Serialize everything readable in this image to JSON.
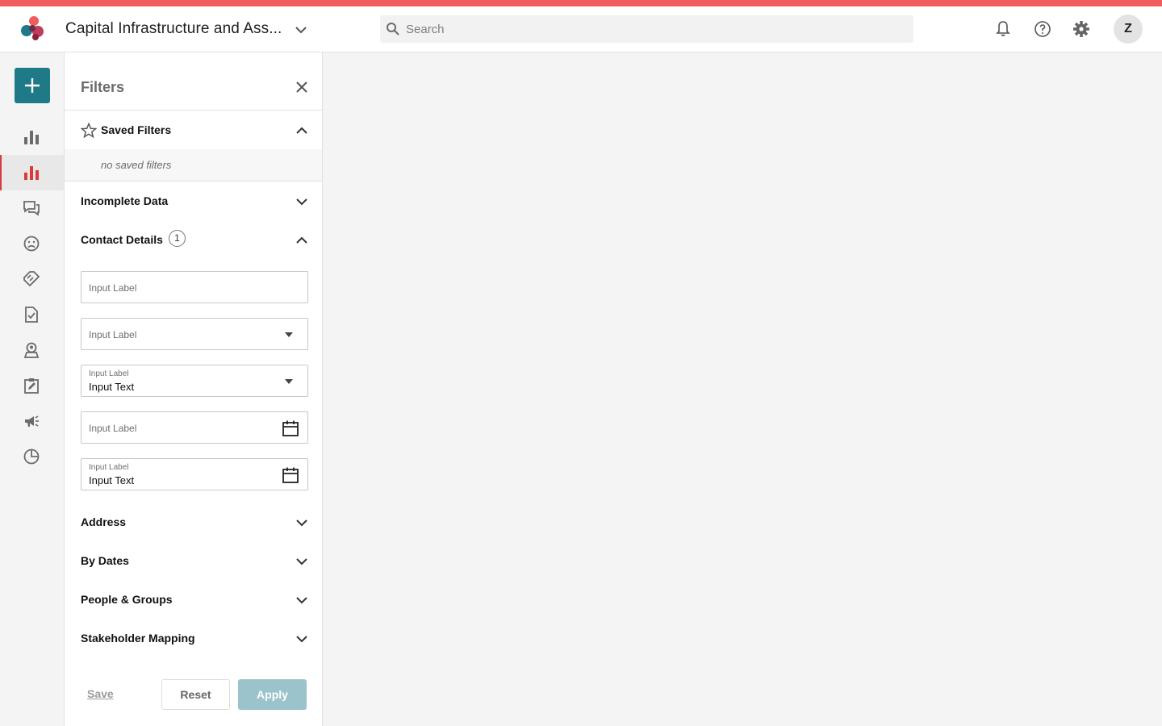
{
  "header": {
    "project_title": "Capital Infrastructure and Ass...",
    "search_placeholder": "Search",
    "avatar_initial": "Z",
    "icons": [
      "bell-icon",
      "help-icon",
      "gear-icon"
    ]
  },
  "colors": {
    "top_stripe": "#ef5e5c",
    "primary": "#1d7a86",
    "apply_disabled": "#9ac3cb",
    "active_nav": "#d93a3a"
  },
  "nav": {
    "add_label": "+",
    "items": [
      {
        "icon": "bar-chart-icon",
        "active": false
      },
      {
        "icon": "bar-chart-icon",
        "active": true
      },
      {
        "icon": "chat-icon",
        "active": false
      },
      {
        "icon": "sad-face-icon",
        "active": false
      },
      {
        "icon": "handshake-icon",
        "active": false
      },
      {
        "icon": "document-check-icon",
        "active": false
      },
      {
        "icon": "location-person-icon",
        "active": false
      },
      {
        "icon": "clipboard-edit-icon",
        "active": false
      },
      {
        "icon": "megaphone-icon",
        "active": false
      },
      {
        "icon": "pie-chart-icon",
        "active": false
      }
    ]
  },
  "filters": {
    "title": "Filters",
    "saved_filters": {
      "label": "Saved Filters",
      "empty_text": "no saved filters",
      "expanded": true
    },
    "incomplete_data": {
      "label": "Incomplete Data",
      "expanded": false
    },
    "contact_details": {
      "label": "Contact Details",
      "count": "1",
      "expanded": true,
      "fields": [
        {
          "type": "text",
          "placeholder": "Input Label"
        },
        {
          "type": "select",
          "placeholder": "Input Label"
        },
        {
          "type": "select",
          "label": "Input Label",
          "value": "Input Text"
        },
        {
          "type": "date",
          "placeholder": "Input Label"
        },
        {
          "type": "date",
          "label": "Input Label",
          "value": "Input Text"
        }
      ]
    },
    "collapsed_sections": [
      {
        "label": "Address"
      },
      {
        "label": "By Dates"
      },
      {
        "label": "People & Groups"
      },
      {
        "label": "Stakeholder Mapping"
      }
    ],
    "actions": {
      "save": "Save",
      "reset": "Reset",
      "apply": "Apply"
    }
  }
}
